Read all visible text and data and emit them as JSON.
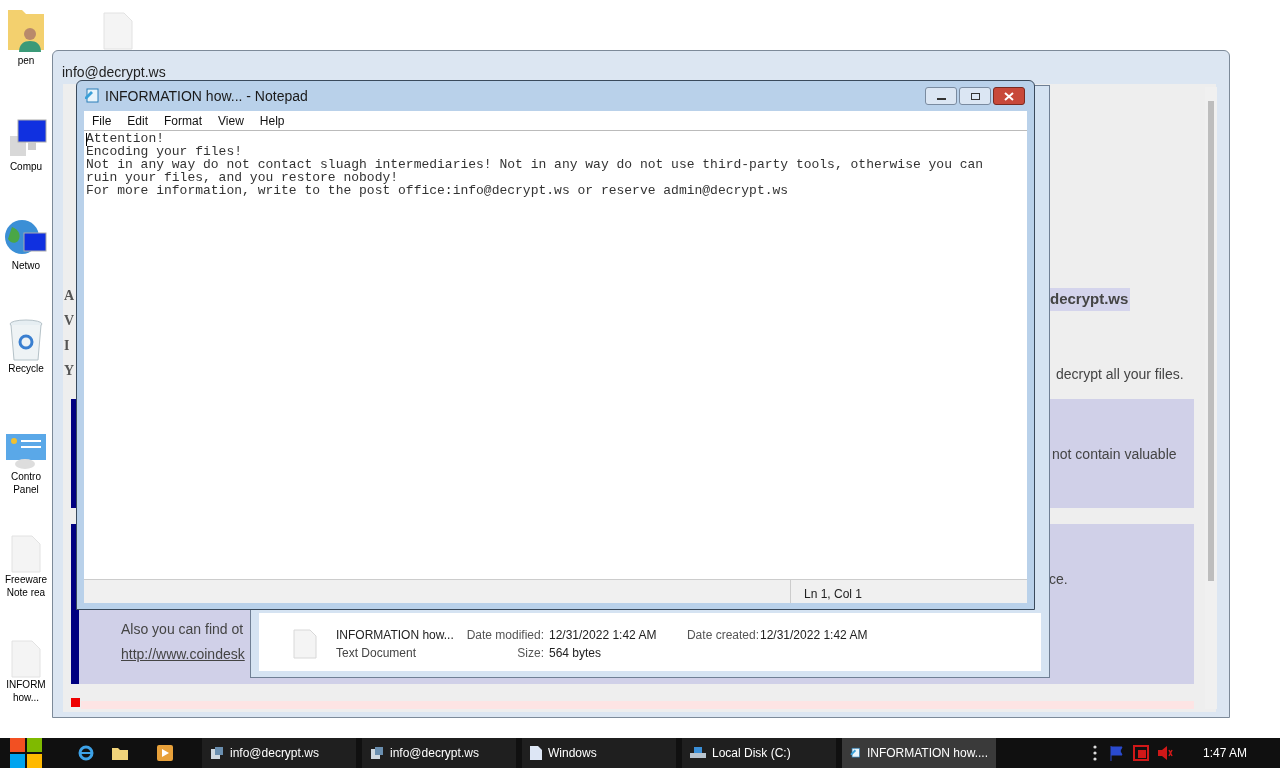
{
  "desktop_icons": [
    {
      "kind": "user-folder",
      "lines": [
        "pen"
      ]
    },
    {
      "kind": "blank-file"
    },
    {
      "kind": "computer",
      "lines": [
        "Compu"
      ]
    },
    {
      "kind": "network",
      "lines": [
        "Netwo"
      ]
    },
    {
      "kind": "recycle",
      "lines": [
        "Recycle"
      ]
    },
    {
      "kind": "control-panel",
      "lines": [
        "Contro",
        "Panel"
      ]
    },
    {
      "kind": "blank-file",
      "lines": [
        "Freeware",
        "Note rea"
      ]
    },
    {
      "kind": "blank-file",
      "lines": [
        "INFORM",
        "how..."
      ]
    }
  ],
  "background_window": {
    "title": "info@decrypt.ws",
    "left_fragments": [
      "A",
      "V",
      "I",
      "Y"
    ],
    "email_fragment": "decrypt.ws",
    "line_fragment": "decrypt all your files.",
    "panel_1_fragment": "not contain valuable",
    "panel_2_fragment": "ce.",
    "panel_2_text": "Also you can find ot",
    "panel_2_link": "http://www.coindesk"
  },
  "explorer_details": {
    "file_name": "INFORMATION how...",
    "file_type": "Text Document",
    "date_modified_label": "Date modified:",
    "date_modified": "12/31/2022 1:42 AM",
    "size_label": "Size:",
    "size": "564 bytes",
    "date_created_label": "Date created:",
    "date_created": "12/31/2022 1:42 AM"
  },
  "notepad": {
    "title": "INFORMATION how... - Notepad",
    "menu": [
      "File",
      "Edit",
      "Format",
      "View",
      "Help"
    ],
    "lines": [
      "Attention!",
      "Encoding your files!",
      "Not in any way do not contact sluagh intermediaries! Not in any way do not use third-party tools, otherwise you can",
      "ruin your files, and you restore nobody!",
      "For more information, write to the post office:info@decrypt.ws or reserve admin@decrypt.ws"
    ],
    "status": "Ln 1, Col 1"
  },
  "taskbar": {
    "tasks": [
      {
        "kind": "app",
        "label": "info@decrypt.ws",
        "selected": false
      },
      {
        "kind": "app",
        "label": "info@decrypt.ws",
        "selected": false
      },
      {
        "kind": "document",
        "label": "Windows",
        "selected": false
      },
      {
        "kind": "drive",
        "label": "Local Disk (C:)",
        "selected": false
      },
      {
        "kind": "notepad",
        "label": "INFORMATION how....",
        "selected": true
      }
    ],
    "clock": "1:47 AM"
  }
}
